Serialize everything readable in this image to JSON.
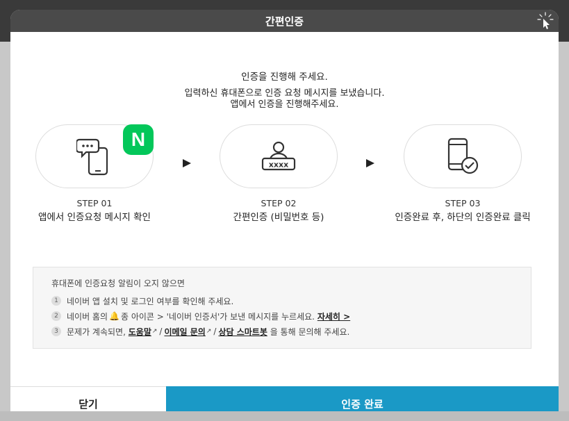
{
  "header": {
    "title": "간편인증"
  },
  "intro": {
    "line1": "인증을 진행해 주세요.",
    "line2": "입력하신 휴대폰으로 인증 요청 메시지를 보냈습니다.",
    "line3": "앱에서 인증을 진행해주세요."
  },
  "badge": {
    "letter": "N",
    "color": "#03c75a"
  },
  "steps": [
    {
      "num": "STEP 01",
      "desc": "앱에서 인증요청 메시지 확인",
      "icon": "phone-chat-icon"
    },
    {
      "num": "STEP 02",
      "desc": "간편인증 (비밀번호 등)",
      "icon": "user-password-icon"
    },
    {
      "num": "STEP 03",
      "desc": "인증완료 후, 하단의 인증완료 클릭",
      "icon": "phone-check-icon"
    }
  ],
  "password_mask": "xxxx",
  "notice": {
    "head": "휴대폰에 인증요청 알림이 오지 않으면",
    "items": [
      {
        "n": "1",
        "text": "네이버 앱 설치 및 로그인 여부를 확인해 주세요."
      },
      {
        "n": "2",
        "pre": "네이버 홈의",
        "mid": "종 아이콘 > '네이버 인증서'가 보낸 메시지를 누르세요.",
        "link": "자세히 >"
      },
      {
        "n": "3",
        "pre": "문제가 계속되면,",
        "link1": "도움말",
        "sep1": "/",
        "link2": "이메일 문의",
        "sep2": "/",
        "link3": "상담 스마트봇",
        "post": "을 통해 문의해 주세요."
      }
    ]
  },
  "footer": {
    "close_label": "닫기",
    "done_label": "인증 완료",
    "accent": "#1a99c6"
  }
}
